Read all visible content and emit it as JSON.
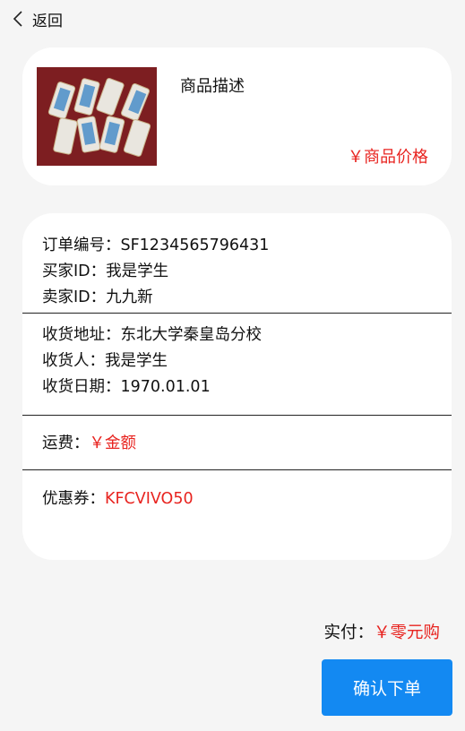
{
  "header": {
    "back_label": "返回"
  },
  "product": {
    "description": "商品描述",
    "price": "￥商品价格"
  },
  "order": {
    "order_no_label": "订单编号：",
    "order_no": "SF1234565796431",
    "buyer_label": "买家ID：",
    "buyer": "我是学生",
    "seller_label": "卖家ID：",
    "seller": "九九新",
    "address_label": "收货地址：",
    "address": "东北大学秦皇岛分校",
    "receiver_label": "收货人：",
    "receiver": "我是学生",
    "date_label": "收货日期：",
    "date": "1970.01.01",
    "shipping_label": "运费：",
    "shipping": "￥金额",
    "coupon_label": "优惠券：",
    "coupon": "KFCVIVO50"
  },
  "footer": {
    "pay_label": "实付：",
    "pay_amount": "￥零元购",
    "confirm_label": "确认下单"
  },
  "colors": {
    "accent_red": "#e8231f",
    "button_blue": "#1389f2",
    "background": "#f5f5f5"
  }
}
